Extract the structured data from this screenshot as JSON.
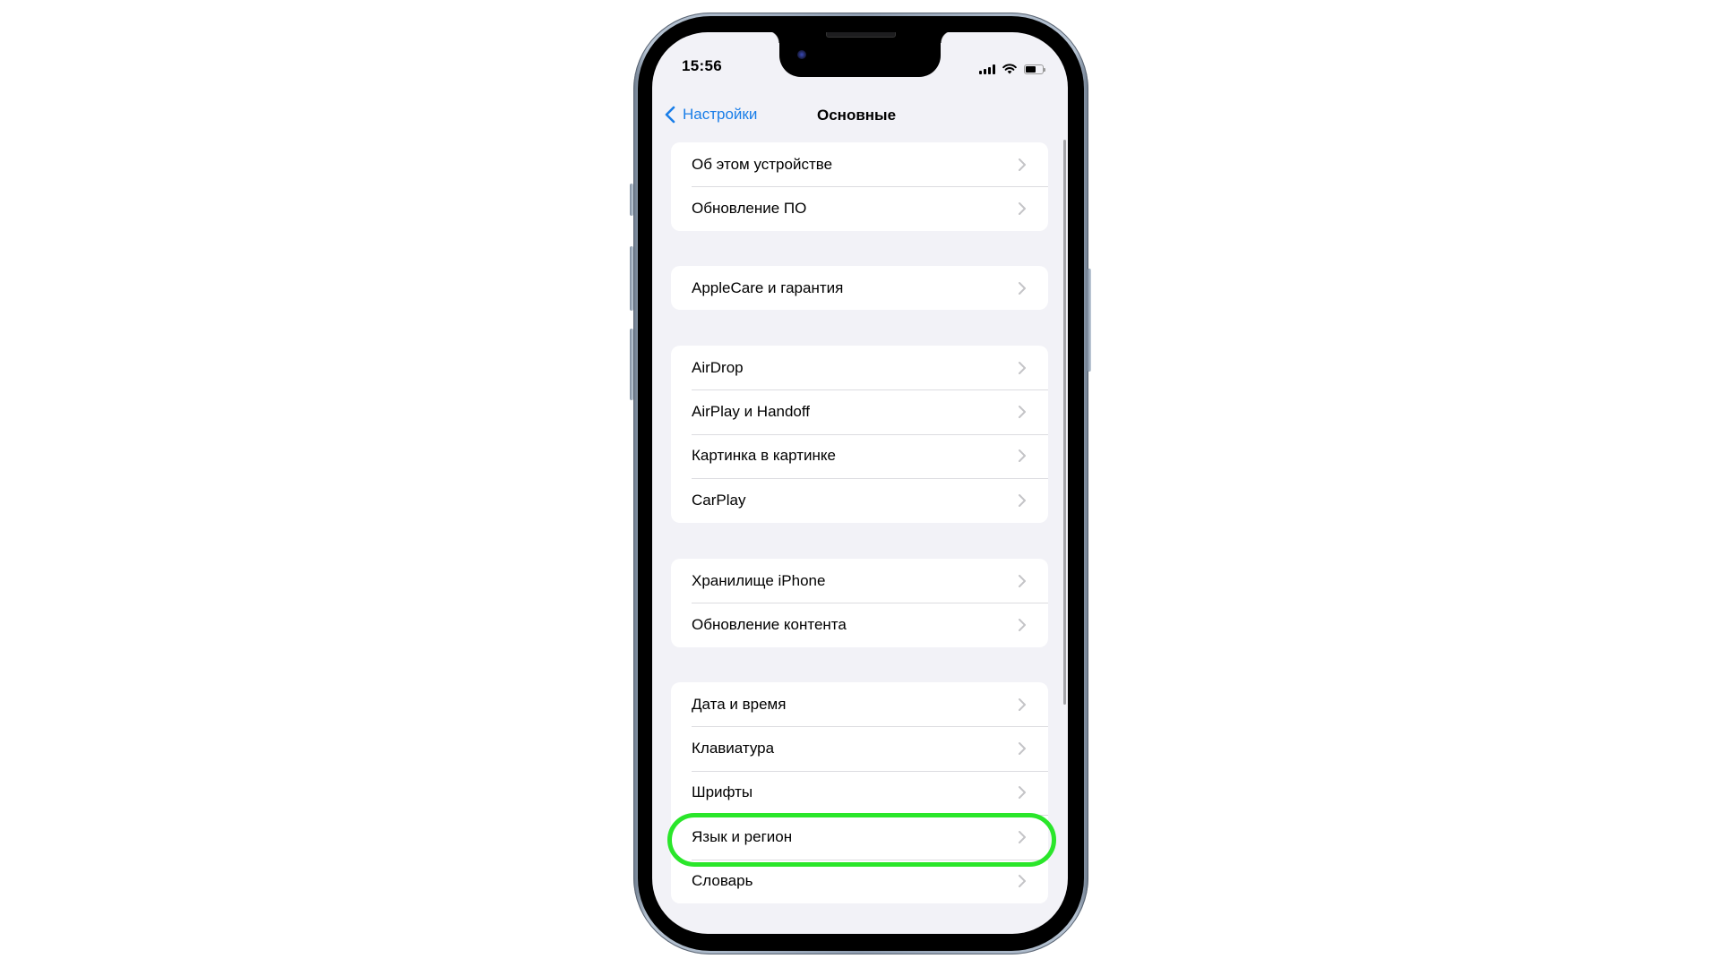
{
  "status_bar": {
    "time": "15:56",
    "icons": [
      "cellular-signal-icon",
      "wifi-icon",
      "battery-icon"
    ],
    "battery_level": 0.6
  },
  "nav": {
    "back_label": "Настройки",
    "back_icon": "chevron-left-icon",
    "title": "Основные"
  },
  "groups": [
    {
      "items": [
        {
          "label": "Об этом устройстве"
        },
        {
          "label": "Обновление ПО"
        }
      ]
    },
    {
      "items": [
        {
          "label": "AppleCare и гарантия"
        }
      ]
    },
    {
      "items": [
        {
          "label": "AirDrop"
        },
        {
          "label": "AirPlay и Handoff"
        },
        {
          "label": "Картинка в картинке"
        },
        {
          "label": "CarPlay"
        }
      ]
    },
    {
      "items": [
        {
          "label": "Хранилище iPhone"
        },
        {
          "label": "Обновление контента"
        }
      ]
    },
    {
      "items": [
        {
          "label": "Дата и время"
        },
        {
          "label": "Клавиатура"
        },
        {
          "label": "Шрифты"
        },
        {
          "label": "Язык и регион"
        },
        {
          "label": "Словарь"
        }
      ]
    }
  ],
  "highlighted_item": "Язык и регион",
  "colors": {
    "accent": "#1a7ee8",
    "highlight": "#2ae62a",
    "background": "#f2f2f7",
    "chevron": "#c4c4c7"
  }
}
